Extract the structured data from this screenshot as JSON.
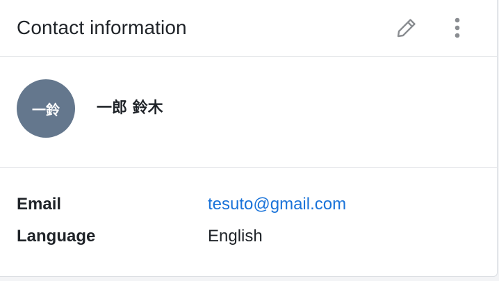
{
  "card": {
    "title": "Contact information"
  },
  "header_actions": {
    "edit_icon": "pencil-icon",
    "more_icon": "vertical-ellipsis-icon"
  },
  "profile": {
    "avatar_initials": "一鈴",
    "name": "一郎 鈴木",
    "avatar_color": "#64778d"
  },
  "details": {
    "email": {
      "label": "Email",
      "value": "tesuto@gmail.com"
    },
    "language": {
      "label": "Language",
      "value": "English"
    }
  },
  "colors": {
    "link": "#1a73d9",
    "text": "#1f2328",
    "divider": "#e3e5e8",
    "icon": "#8a8d91"
  }
}
